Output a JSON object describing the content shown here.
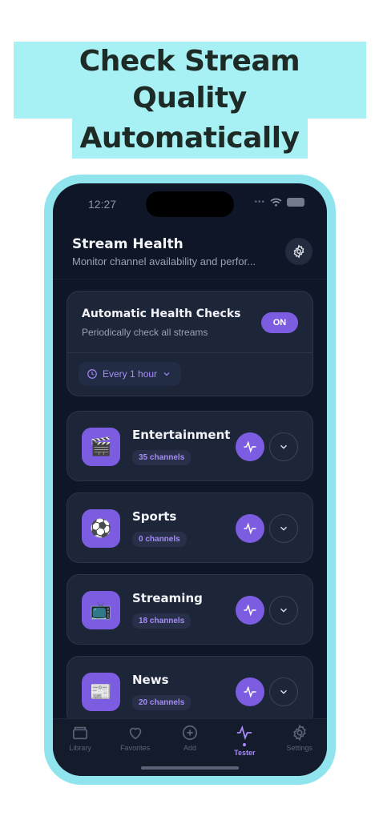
{
  "promo": {
    "line1": "Check Stream Quality",
    "line2": "Automatically"
  },
  "status_bar": {
    "time": "12:27"
  },
  "header": {
    "title": "Stream Health",
    "subtitle": "Monitor channel availability and perfor..."
  },
  "auto_checks": {
    "title": "Automatic Health Checks",
    "subtitle": "Periodically check all streams",
    "toggle_label": "ON",
    "interval_label": "Every 1 hour"
  },
  "categories": [
    {
      "name": "Entertainment",
      "count": "35 channels",
      "icon": "🎬"
    },
    {
      "name": "Sports",
      "count": "0 channels",
      "icon": "⚽"
    },
    {
      "name": "Streaming",
      "count": "18 channels",
      "icon": "📺"
    },
    {
      "name": "News",
      "count": "20 channels",
      "icon": "📰"
    }
  ],
  "tabs": [
    {
      "label": "Library",
      "icon": "folder-icon"
    },
    {
      "label": "Favorites",
      "icon": "heart-icon"
    },
    {
      "label": "Add",
      "icon": "plus-circle-icon"
    },
    {
      "label": "Tester",
      "icon": "pulse-icon",
      "active": true
    },
    {
      "label": "Settings",
      "icon": "gear-icon"
    }
  ],
  "colors": {
    "accent": "#7c5ce0",
    "accent_text": "#a78bfa",
    "banner": "#a7f0f3",
    "device": "#8fe4ee",
    "background": "#0f1628"
  }
}
